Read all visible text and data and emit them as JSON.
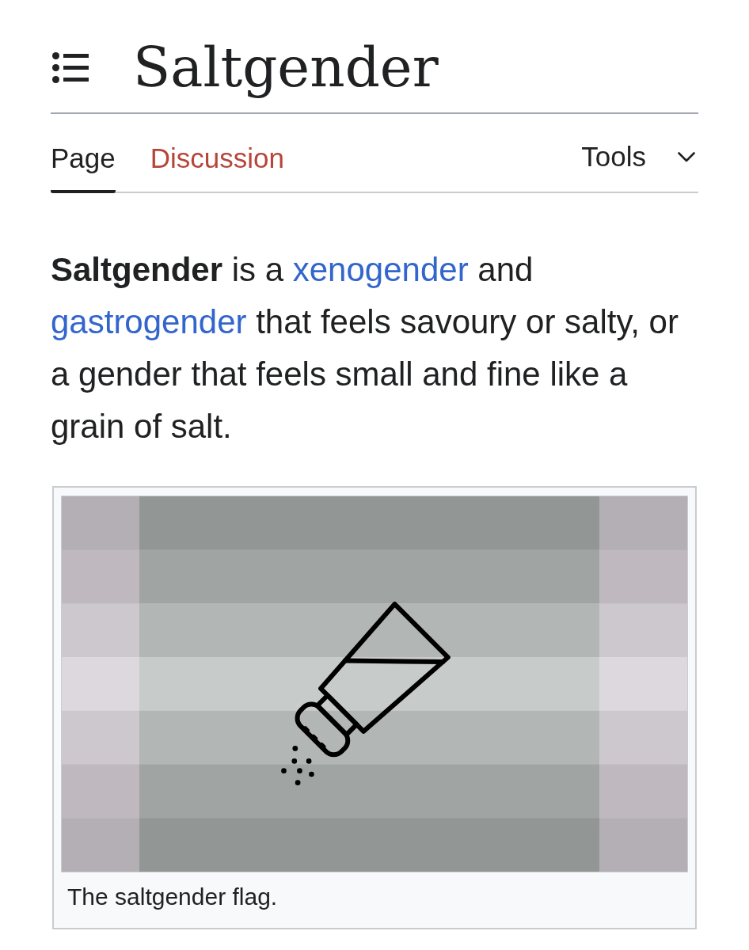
{
  "page_title": "Saltgender",
  "tabs": [
    {
      "label": "Page",
      "selected": true,
      "missing": false
    },
    {
      "label": "Discussion",
      "selected": false,
      "missing": true
    }
  ],
  "tools_menu": {
    "label": "Tools",
    "expanded": false
  },
  "article": {
    "lead": [
      {
        "kind": "bold",
        "text": "Saltgender"
      },
      {
        "kind": "text",
        "text": " is a "
      },
      {
        "kind": "link",
        "text": "xenogender"
      },
      {
        "kind": "text",
        "text": " and "
      },
      {
        "kind": "link",
        "text": "gastrogender"
      },
      {
        "kind": "text",
        "text": " that feels savoury or salty, or a gender that feels small and fine like a grain of salt."
      }
    ],
    "figure": {
      "caption": "The saltgender flag."
    }
  }
}
